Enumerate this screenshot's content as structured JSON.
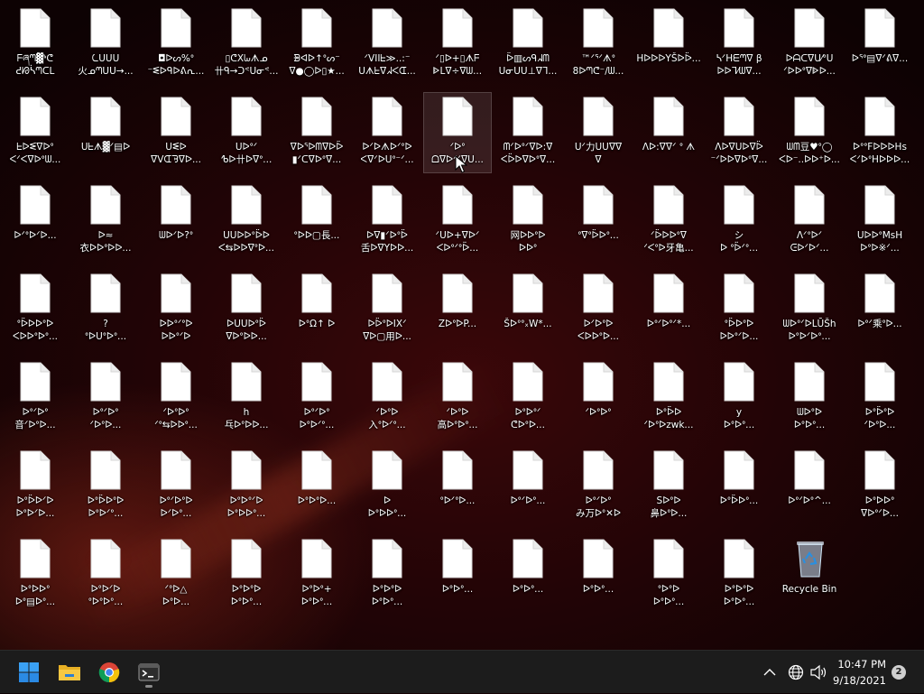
{
  "desktop": {
    "icons": [
      {
        "label": "ᖴཞᘉ▓ᔉᕦ\nᕍᘙᓵᘉᑕᒪ"
      },
      {
        "label": "ᘇᑌᑌᑌ\n火ᓄᘉᑌᑌ→..."
      },
      {
        "label": "◘ᐅᔕ%ᐤ\n⁻ᓬᐅᑫᐅᕕᕆ..."
      },
      {
        "label": "▯ᕦXᘈᗑᓄ\n卄ᑫ→ᑐᕝᑌᓂᕝ..."
      },
      {
        "label": "ᗾᐊᐅ↑ᐤᔕ⁻\nᐁ●◯ᐅ▯★..."
      },
      {
        "label": "ᐟVIIᖶ≫..:⁻\nᑌᗑᖶᐁᖽᐸᗭ..."
      },
      {
        "label": "ᐟ▯ᐅ+▯ᗑᖴ\nᐈᒪᐁ÷ᐁᗯ..."
      },
      {
        "label": "ᐇ▥ᔕᑫᖽᗰ\nᑌᓂᑌᑌ⊥ᐁᒣ..."
      },
      {
        "label": "™ᐟᕐᐟᗑᐤ\n8ᐅᘉᕦ⁻/ᗯ..."
      },
      {
        "label": "HᐅᐅᐅYŠᐅᐇ...\n"
      },
      {
        "label": "ᓴᐟHᗴᘉᐁ β\nᐅᐅᒣ⁄ᗯᐁ..."
      },
      {
        "label": "ᐅᗩᑕᐁᑌ⁄ᐤᑌ\nᐟᐅᐅᐤᐁᐈᐅ..."
      },
      {
        "label": "ᐅᕐᐤ▤ᐁᐟᕕᐁ..."
      },
      {
        "label": "ᖶᐅᓬᐁᐅᐤ\nᐸᐟᐸᐁᐅᐤᗯ..."
      },
      {
        "label": "ᑌᖶᗑ▓ᐟ▤ᐅ\n"
      },
      {
        "label": "ᑌᓬᐅ\nᐁᐯᗭᘋᐁᐅ..."
      },
      {
        "label": "ᑌᐅᐤᐟ\nᕹᐅ卄ᐅᐁᐤ..."
      },
      {
        "label": "ᐁᐅᕐᐅᗰᐁᐅᐇ\n▮ᐟᑕᐁᐅᐤᐁ..."
      },
      {
        "label": "ᐅᐟᐅᗑᐅᐟᐤᐅ\nᐸᐁᐟᐅᑌᐤ⁻ᐟ..."
      },
      {
        "label": "ᐟᐅᐤ\nᗝᐁᐅᐟᐟᐁᑌ..."
      },
      {
        "label": "ᗰᐟᐅᐤᐟᐁᐅ:ᐁ\nᐸᐇᐅᐁᐅᐤᐁ..."
      },
      {
        "label": "ᑌᐟ力ᑌᑌᐁᐁ\nᐁ"
      },
      {
        "label": "ᐱᐅ:ᐁᐁᐟ ᐤ ᗑ\n"
      },
      {
        "label": "ᐱᐅᐁᑌᐅᐁᐇ\n⁻ᐟᐅᐅᐁᐅᐤᐁ..."
      },
      {
        "label": "ᗯᗰ豆♥ᐤ◯\nᐸᐅ⁻..ᐅᐅ⁺ᐅ..."
      },
      {
        "label": "ᐅᐤᐤFᐅᐅᐅHs\nᐸᐟᐅᐤHᐅᐅᐅ..."
      },
      {
        "label": "ᐅᐟᐤᐅᐟᐅ..."
      },
      {
        "label": "ᐅ≈\n衣ᐅᐅᐤᐅᐅ..."
      },
      {
        "label": "ᗯᐅᐟᐅ?ᐤ\n"
      },
      {
        "label": "ᑌᑌᐅᐅᐤᐇᐅ\nᐸ⇆ᐅᐅᐁᐤᐅ..."
      },
      {
        "label": "ᐤᐅᐅ▢長...\n"
      },
      {
        "label": "ᐅᐁ▮ᐟᐅᐤᐇ\n舌ᐅᐁYᐅᐅ..."
      },
      {
        "label": "ᐟᑌᐅ+ᐁᐅᐟ\nᐸᐅᐤᐟᐤᐇ..."
      },
      {
        "label": "网ᐅᐅᐤᐅ\nᐅᐅᐤ"
      },
      {
        "label": "ᐤᐁᐤᐇᐅᐤ..."
      },
      {
        "label": "ᐟᐇᐅᐅᐤᐁ\nᐟᐸᐤᐅ牙亀..."
      },
      {
        "label": "シ\nᐅ ᐤᐇᐟᐤ..."
      },
      {
        "label": "ᐱᐟᐤᐅᐟ\nᕮᐅᐟᐅᐟ..."
      },
      {
        "label": "ᑌᐅᐅᐤMsH\nᐅᐤᐅ※ᐟ..."
      },
      {
        "label": "ᐤᐇᐅᐅᐤᐅ\nᐸᐅᐅᐤᐅᐤ..."
      },
      {
        "label": "?\nᐤᐅᑌᐤᐅᐤ..."
      },
      {
        "label": "ᐅᐅᐤᐟᐤᐅ\nᐅᐅᐤᐟᐅ"
      },
      {
        "label": "ᐅᑌᑌᐅᐤᐇ\nᐁᐅᐤᐅᐅ..."
      },
      {
        "label": "ᐅᐤΩ↑ ᐅ\n"
      },
      {
        "label": "ᐅᐇᐤᐅIXᐟ\nᐁᐅ▢用ᐅ..."
      },
      {
        "label": "ZᐅᐤᐅP...\n"
      },
      {
        "label": "Šᐅᐤᐤ᙮W*...\n"
      },
      {
        "label": "ᐅᐟᐅᐤᐅ\nᐸᐅᐅᐤᐅ..."
      },
      {
        "label": "ᐅᐤᐟᐅᐤᐟ*...\n"
      },
      {
        "label": "ᐤᐇᐅᐤᐅ\nᐅᐅᐤᐟᐅ..."
      },
      {
        "label": "ᗯᐅᐤᐟᐅLŪŠh\nᐅᐤᐅᐟᐅᐤ..."
      },
      {
        "label": "ᐅᐤᐟ乘ᐤᐅ..."
      },
      {
        "label": "ᐅᐤᐟᐅᐤ\n音ᐟᐅᐤᐅ..."
      },
      {
        "label": "ᐅᐤᐟᐅᐤ\nᐟᐅᐤᐅ..."
      },
      {
        "label": "ᐟᐅᐤᐅᐤ\nᐟᐤ⇆ᐅᐅᐤ..."
      },
      {
        "label": "h\n乓ᐅᐤᐅᐅ..."
      },
      {
        "label": "ᐅᐤᐟᐅᐤ\nᐅᐤᐅᐟᐤ..."
      },
      {
        "label": "ᐟᐅᐤᐅ\n入ᐤᐅᐟᐤ..."
      },
      {
        "label": "ᐟᐅᐤᐅ\n高ᐅᐤᐅᐤ..."
      },
      {
        "label": "ᐅᐤᐅᐤᐟ\nᕦᐅᐤᐅ..."
      },
      {
        "label": "ᐟᐅᐤᐅᐤ\n"
      },
      {
        "label": "ᐅᐤᐇᐅ\nᐟᐅᐤᐅzwk..."
      },
      {
        "label": "y\nᐅᐤᐅᐤ..."
      },
      {
        "label": "ᗯᐅᐤᐅ\nᐅᐤᐅᐤ..."
      },
      {
        "label": "ᐅᐤᐇᐤᐅ\nᐟᐅᐤᐅ..."
      },
      {
        "label": "ᐅᐤᐇᐅᐟᐅ\nᐅᐤᐅᐟᐅ..."
      },
      {
        "label": "ᐅᐤᐇᐅᐤᐅ\nᐅᐤᐅᐟᐤ..."
      },
      {
        "label": "ᐅᐤᐟᐅᐤᐅ\nᐅᐟᐅᐤ..."
      },
      {
        "label": "ᐅᐤᐅᐤᐟᐅ\nᐅᐤᐅᐅᐤ..."
      },
      {
        "label": "ᐅᐤᐅᐤᐅ...\n"
      },
      {
        "label": "ᐅ\nᐅᐤᐅᐅᐤ..."
      },
      {
        "label": "ᐤᐅᐟᐤᐅ...\n"
      },
      {
        "label": "ᐅᐤᐟᐅᐤ...\n"
      },
      {
        "label": "ᐅᐤᐟᐅᐤ\nみ万ᐅᐤ✕ᐅ"
      },
      {
        "label": "Sᐅᐤᐅ\n鼻ᐅᐤᐅ..."
      },
      {
        "label": "ᐅᐤᐇᐅᐤ...\n"
      },
      {
        "label": "ᐅᐤᐟᐅᐤ^...\n"
      },
      {
        "label": "ᐅᐤᐅᐅᐤ\nᐁᐅᐤᐟᐅ..."
      },
      {
        "label": "ᐅᐤᐅᐅᐤ\nᐅᐤ▤ᐅᐤ..."
      },
      {
        "label": "ᐅᐤᐅᐟᐅ\nᐤᐅᐤᐅᐤ..."
      },
      {
        "label": "ᐟᐤᐅ△\nᐅᐤᐅ..."
      },
      {
        "label": "ᐅᐤᐅᐤᐅ\nᐅᐤᐅᐤ..."
      },
      {
        "label": "ᐅᐤᐅᐤ+\nᐅᐤᐅᐤ..."
      },
      {
        "label": "ᐅᐤᐅᐤᐅ\nᐅᐤᐅᐤ..."
      },
      {
        "label": "ᐅᐤᐅᐤ...\n"
      },
      {
        "label": "ᐅᐤᐅᐤ...\n"
      },
      {
        "label": "ᐅᐤᐅᐤ...\n"
      },
      {
        "label": "ᐤᐅᐤᐅ\nᐅᐤᐅᐤ..."
      },
      {
        "label": "ᐅᐤᐅᐤᐅ\nᐅᐤᐅᐤ..."
      },
      {
        "label": "Recycle Bin",
        "type": "recycle-bin"
      }
    ],
    "selected_index": 19
  },
  "taskbar": {
    "apps": [
      {
        "name": "start-button",
        "icon": "windows-logo-icon"
      },
      {
        "name": "file-explorer",
        "icon": "folder-icon"
      },
      {
        "name": "chrome",
        "icon": "chrome-icon"
      },
      {
        "name": "terminal",
        "icon": "terminal-icon",
        "active": true
      }
    ],
    "tray": {
      "chevron": "^",
      "time": "10:47 PM",
      "date": "9/18/2021",
      "notifications": "2"
    }
  },
  "colors": {
    "accent_blue": "#0078d4",
    "taskbar_bg": "#1c1c1c"
  }
}
